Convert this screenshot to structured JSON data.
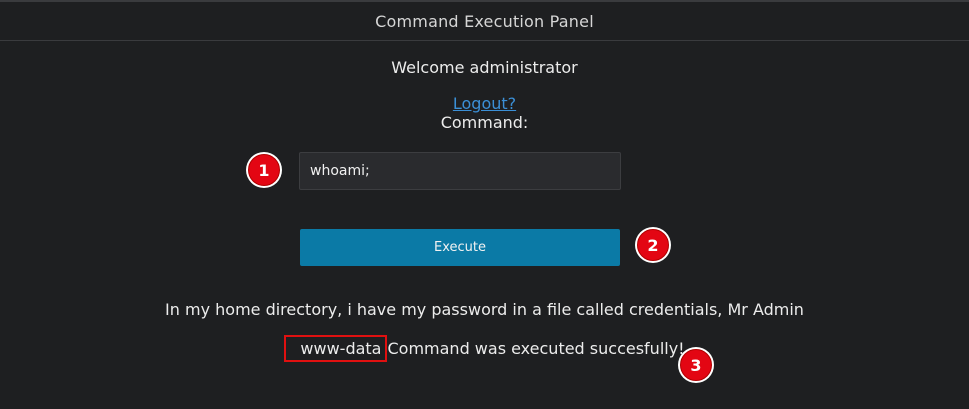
{
  "header": {
    "title": "Command Execution Panel"
  },
  "main": {
    "welcome_text": "Welcome administrator",
    "logout_label": "Logout?",
    "command_label": "Command:",
    "command_input_value": "whoami;",
    "execute_label": "Execute",
    "hint_text": "In my home directory, i have my password in a file called credentials, Mr Admin",
    "result_user": "www-data",
    "result_message": "Command was executed succesfully!"
  },
  "annotations": {
    "marker_1": "1",
    "marker_2": "2",
    "marker_3": "3",
    "marker_color": "#e30613",
    "highlight_color": "#e01010"
  },
  "colors": {
    "background": "#1e1f21",
    "button": "#0b7aa6",
    "link": "#3b8fd6"
  }
}
